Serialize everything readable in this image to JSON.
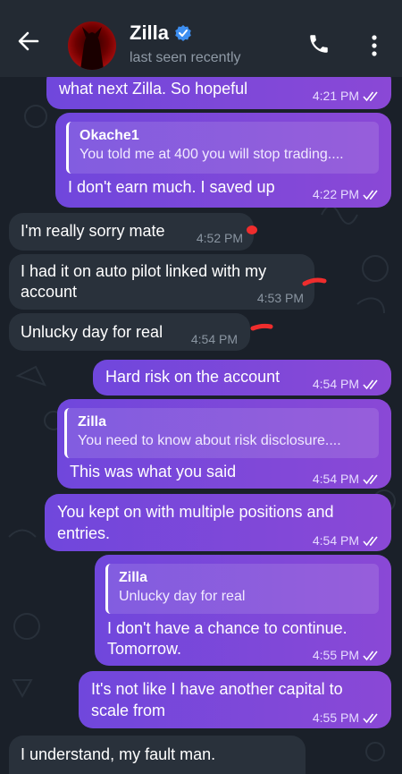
{
  "header": {
    "contact_name": "Zilla",
    "status": "last seen recently",
    "back_icon": "arrow-left-icon",
    "verified_icon": "verified-badge-icon",
    "call_icon": "phone-icon",
    "menu_icon": "more-vertical-icon"
  },
  "colors": {
    "outgoing_bubble": "#7a48d9",
    "incoming_bubble": "#29313b",
    "background": "#1a2029",
    "header": "#232a33",
    "verified": "#3d8ef0",
    "annotation_red": "#ef2d2d"
  },
  "messages": [
    {
      "direction": "out",
      "text": "what next Zilla. So hopeful",
      "time": "4:21 PM"
    },
    {
      "direction": "out",
      "reply_to_name": "Okache1",
      "reply_to_text": "You told me at 400 you will stop trading....",
      "text": "I don't earn much. I saved up",
      "time": "4:22 PM"
    },
    {
      "direction": "in",
      "text": "I'm really sorry mate",
      "time": "4:52 PM"
    },
    {
      "direction": "in",
      "text_lines": [
        "I had it on auto pilot linked with my",
        "account"
      ],
      "time": "4:53 PM"
    },
    {
      "direction": "in",
      "text": "Unlucky day for real",
      "time": "4:54 PM"
    },
    {
      "direction": "out",
      "text": "Hard risk on the account",
      "time": "4:54 PM"
    },
    {
      "direction": "out",
      "reply_to_name": "Zilla",
      "reply_to_text": "You need to know about risk disclosure....",
      "text": "This was what you said",
      "time": "4:54 PM"
    },
    {
      "direction": "out",
      "text_lines": [
        "You kept on with multiple positions and",
        "entries."
      ],
      "time": "4:54 PM"
    },
    {
      "direction": "out",
      "reply_to_name": "Zilla",
      "reply_to_text": "Unlucky day for real",
      "text_lines": [
        "I don't have a chance to continue.",
        "Tomorrow."
      ],
      "time": "4:55 PM"
    },
    {
      "direction": "out",
      "text_lines": [
        "It's not like I have another capital to",
        "scale from"
      ],
      "time": "4:55 PM"
    },
    {
      "direction": "in",
      "text": "I understand, my fault man."
    }
  ]
}
